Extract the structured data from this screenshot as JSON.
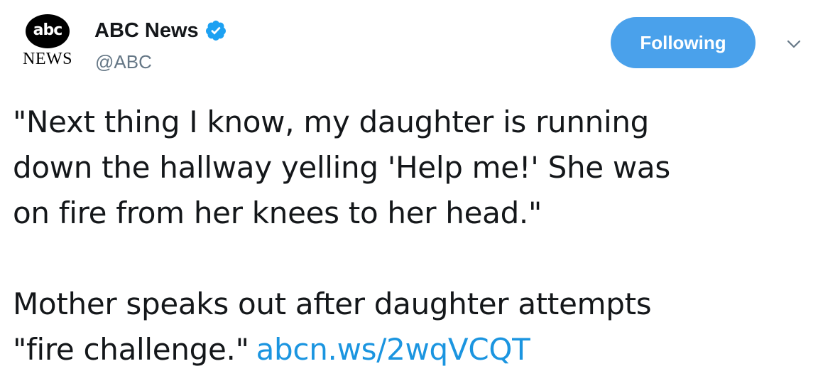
{
  "account": {
    "logo_top": "abc",
    "logo_bottom": "NEWS",
    "display_name": "ABC News",
    "handle": "@ABC",
    "verified_icon": "verified-badge-icon"
  },
  "actions": {
    "follow_label": "Following",
    "menu_icon": "chevron-down-icon"
  },
  "tweet": {
    "line1": "\"Next thing I know, my daughter is running",
    "line2": "down the hallway yelling 'Help me!' She was",
    "line3": "on fire from her knees to her head.\"",
    "line4": "Mother speaks out after daughter attempts",
    "line5": "\"fire challenge.\"",
    "link": "abcn.ws/2wqVCQT"
  },
  "colors": {
    "accent": "#1b95e0",
    "button": "#4aa1eb",
    "handle": "#657786",
    "text": "#14171a"
  }
}
